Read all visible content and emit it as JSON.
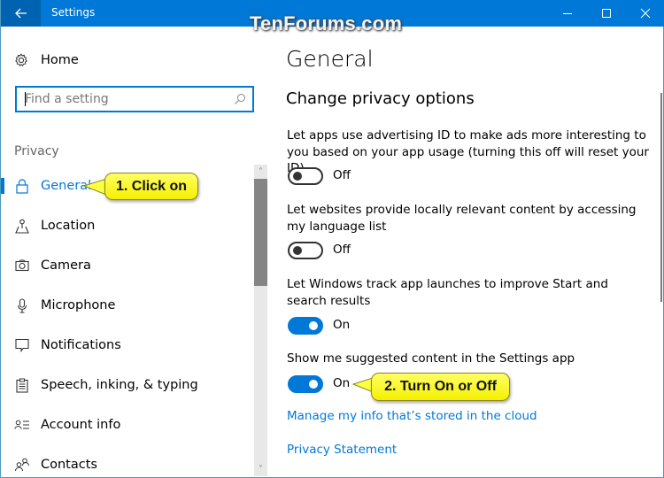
{
  "window": {
    "title": "Settings",
    "watermark": "TenForums.com",
    "controls": {
      "minimize": "minimize-icon",
      "maximize": "maximize-icon",
      "close": "close-icon"
    }
  },
  "sidebar": {
    "home_label": "Home",
    "search": {
      "placeholder": "Find a setting",
      "value": ""
    },
    "section_label": "Privacy",
    "items": [
      {
        "label": "General",
        "icon": "lock-icon",
        "active": true
      },
      {
        "label": "Location",
        "icon": "location-icon",
        "active": false
      },
      {
        "label": "Camera",
        "icon": "camera-icon",
        "active": false
      },
      {
        "label": "Microphone",
        "icon": "microphone-icon",
        "active": false
      },
      {
        "label": "Notifications",
        "icon": "notifications-icon",
        "active": false
      },
      {
        "label": "Speech, inking, & typing",
        "icon": "speech-icon",
        "active": false
      },
      {
        "label": "Account info",
        "icon": "account-info-icon",
        "active": false
      },
      {
        "label": "Contacts",
        "icon": "contacts-icon",
        "active": false
      }
    ]
  },
  "main": {
    "title": "General",
    "subtitle": "Change privacy options",
    "settings": [
      {
        "text": "Let apps use advertising ID to make ads more interesting to you based on your app usage (turning this off will reset your ID)",
        "state": "Off",
        "on": false
      },
      {
        "text": "Let websites provide locally relevant content by accessing my language list",
        "state": "Off",
        "on": false
      },
      {
        "text": "Let Windows track app launches to improve Start and search results",
        "state": "On",
        "on": true
      },
      {
        "text": "Show me suggested content in the Settings app",
        "state": "On",
        "on": true
      }
    ],
    "links": [
      "Manage my info that’s stored in the cloud",
      "Privacy Statement"
    ]
  },
  "callouts": [
    "1. Click on",
    "2. Turn On or Off"
  ],
  "colors": {
    "accent": "#0078d7",
    "titlebar_back": "#0063b1",
    "callout": "#ffff33"
  }
}
